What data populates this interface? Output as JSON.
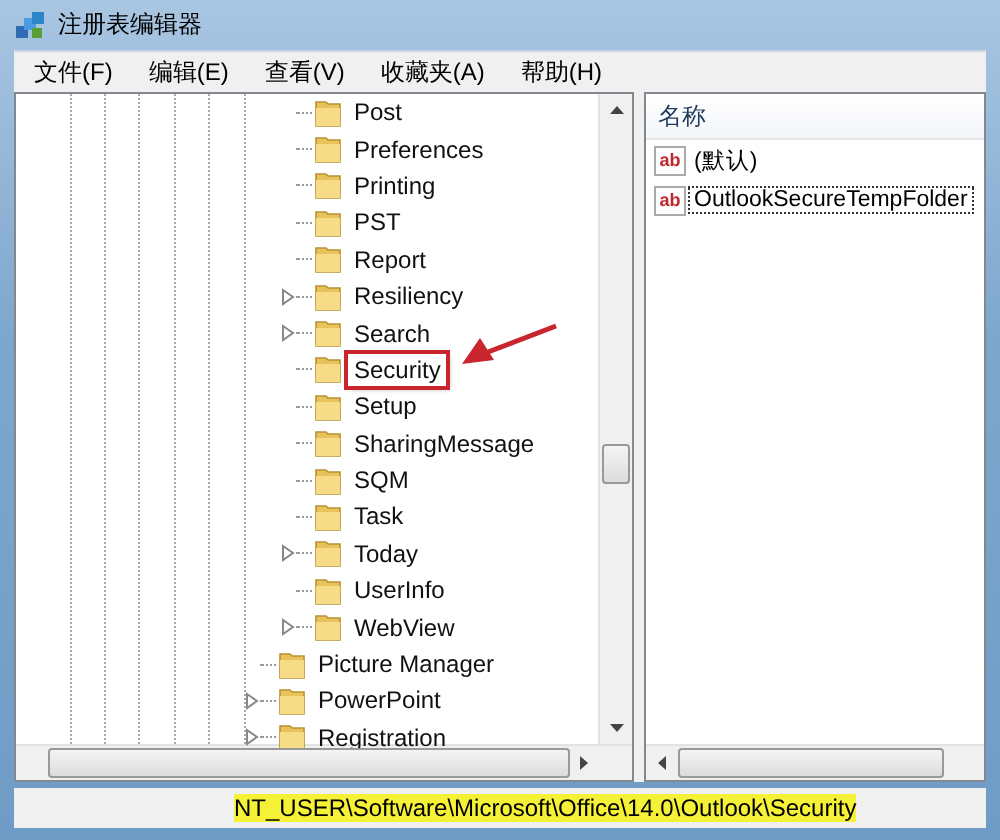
{
  "window": {
    "title": "注册表编辑器"
  },
  "menu": [
    "文件(F)",
    "编辑(E)",
    "查看(V)",
    "收藏夹(A)",
    "帮助(H)"
  ],
  "tree": {
    "nested_items": [
      {
        "label": "Post",
        "expandable": false,
        "annotated": false
      },
      {
        "label": "Preferences",
        "expandable": false,
        "annotated": false
      },
      {
        "label": "Printing",
        "expandable": false,
        "annotated": false
      },
      {
        "label": "PST",
        "expandable": false,
        "annotated": false
      },
      {
        "label": "Report",
        "expandable": false,
        "annotated": false
      },
      {
        "label": "Resiliency",
        "expandable": true,
        "annotated": false
      },
      {
        "label": "Search",
        "expandable": true,
        "annotated": false
      },
      {
        "label": "Security",
        "expandable": false,
        "annotated": true
      },
      {
        "label": "Setup",
        "expandable": false,
        "annotated": false
      },
      {
        "label": "SharingMessage",
        "expandable": false,
        "annotated": false
      },
      {
        "label": "SQM",
        "expandable": false,
        "annotated": false
      },
      {
        "label": "Task",
        "expandable": false,
        "annotated": false
      },
      {
        "label": "Today",
        "expandable": true,
        "annotated": false
      },
      {
        "label": "UserInfo",
        "expandable": false,
        "annotated": false
      },
      {
        "label": "WebView",
        "expandable": true,
        "annotated": false
      }
    ],
    "items": [
      {
        "label": "Picture Manager",
        "expandable": false,
        "annotated": false
      },
      {
        "label": "PowerPoint",
        "expandable": true,
        "annotated": false
      },
      {
        "label": "Registration",
        "expandable": true,
        "annotated": false
      }
    ]
  },
  "values": {
    "columns": [
      "名称"
    ],
    "rows": [
      {
        "type_icon": "ab",
        "name": "(默认)",
        "focused": false
      },
      {
        "type_icon": "ab",
        "name": "OutlookSecureTempFolder",
        "focused": true
      }
    ]
  },
  "status_bar": {
    "path": "NT_USER\\Software\\Microsoft\\Office\\14.0\\Outlook\\Security",
    "highlighted": true
  }
}
